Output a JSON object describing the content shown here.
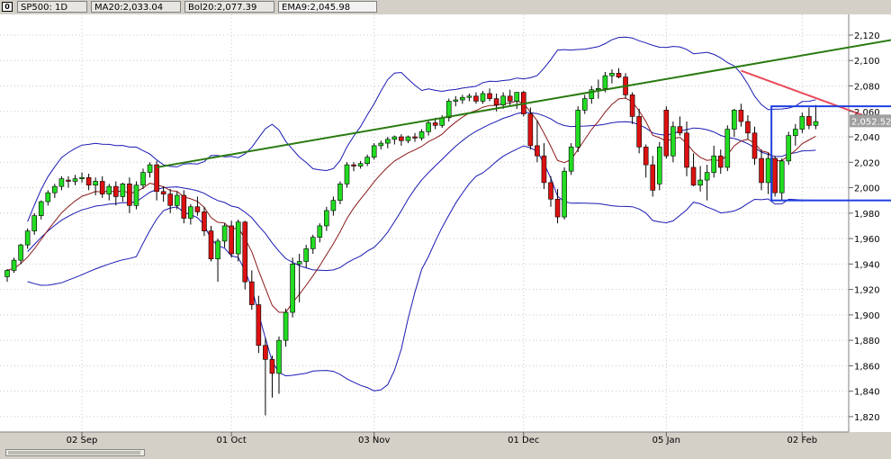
{
  "header": {
    "icon_label": "0",
    "symbol": "SP500: 1D",
    "ma": "MA20:2,033.04",
    "bol": "Bol20:2,077.39",
    "ema": "EMA9:2,045.98"
  },
  "colors": {
    "up": "#22dd22",
    "down": "#dd1111",
    "bands": "#1a1ab4",
    "ma": "#8b1a1a",
    "green_trendline": "#2a7a10",
    "red_trendline": "#ea4a5a",
    "range_box": "#2040e0"
  },
  "chart_data": {
    "type": "candlestick",
    "ylim": [
      1815,
      2132
    ],
    "y_ticks": [
      1820,
      1840,
      1860,
      1880,
      1900,
      1920,
      1940,
      1960,
      1980,
      2000,
      2020,
      2040,
      2060,
      2080,
      2100,
      2120
    ],
    "x_labels": [
      "02 Sep",
      "01 Oct",
      "03 Nov",
      "01 Dec",
      "05 Jan",
      "02 Feb"
    ],
    "x_label_index": [
      11,
      33,
      54,
      76,
      97,
      117
    ],
    "last_price": "2,052.52",
    "candles": [
      [
        1930,
        1936,
        1926,
        1935
      ],
      [
        1935,
        1945,
        1933,
        1943
      ],
      [
        1943,
        1956,
        1940,
        1955
      ],
      [
        1955,
        1968,
        1952,
        1966
      ],
      [
        1966,
        1980,
        1963,
        1978
      ],
      [
        1978,
        1990,
        1975,
        1989
      ],
      [
        1989,
        1998,
        1986,
        1996
      ],
      [
        1996,
        2003,
        1992,
        2001
      ],
      [
        2001,
        2009,
        1998,
        2007
      ],
      [
        2006,
        2009,
        2000,
        2005
      ],
      [
        2005,
        2010,
        2002,
        2007
      ],
      [
        2007,
        2012,
        2004,
        2008
      ],
      [
        2008,
        2011,
        1998,
        2002
      ],
      [
        2002,
        2008,
        1994,
        2005
      ],
      [
        2005,
        2009,
        1992,
        1995
      ],
      [
        1995,
        2003,
        1990,
        2001
      ],
      [
        2001,
        2005,
        1986,
        1993
      ],
      [
        1993,
        2004,
        1989,
        2003
      ],
      [
        2003,
        2008,
        1980,
        1986
      ],
      [
        1986,
        2005,
        1983,
        2002
      ],
      [
        2002,
        2015,
        1999,
        2012
      ],
      [
        2012,
        2020,
        2008,
        2018
      ],
      [
        2018,
        2021,
        1990,
        1997
      ],
      [
        1997,
        2001,
        1989,
        1995
      ],
      [
        1995,
        1999,
        1980,
        1986
      ],
      [
        1986,
        1997,
        1983,
        1994
      ],
      [
        1994,
        1998,
        1972,
        1976
      ],
      [
        1976,
        1987,
        1971,
        1985
      ],
      [
        1985,
        1993,
        1978,
        1981
      ],
      [
        1981,
        1985,
        1962,
        1966
      ],
      [
        1966,
        1970,
        1942,
        1944
      ],
      [
        1944,
        1960,
        1926,
        1958
      ],
      [
        1958,
        1972,
        1953,
        1970
      ],
      [
        1970,
        1974,
        1945,
        1948
      ],
      [
        1948,
        1975,
        1942,
        1973
      ],
      [
        1973,
        1974,
        1920,
        1926
      ],
      [
        1926,
        1935,
        1904,
        1908
      ],
      [
        1908,
        1915,
        1870,
        1876
      ],
      [
        1876,
        1882,
        1821,
        1865
      ],
      [
        1865,
        1868,
        1835,
        1854
      ],
      [
        1854,
        1883,
        1838,
        1880
      ],
      [
        1880,
        1905,
        1875,
        1902
      ],
      [
        1902,
        1945,
        1898,
        1940
      ],
      [
        1940,
        1948,
        1910,
        1942
      ],
      [
        1942,
        1955,
        1937,
        1952
      ],
      [
        1952,
        1963,
        1948,
        1961
      ],
      [
        1961,
        1972,
        1957,
        1970
      ],
      [
        1970,
        1985,
        1966,
        1982
      ],
      [
        1982,
        1993,
        1978,
        1990
      ],
      [
        1990,
        2005,
        1987,
        2003
      ],
      [
        2003,
        2020,
        2000,
        2018
      ],
      [
        2018,
        2020,
        2013,
        2017
      ],
      [
        2017,
        2021,
        2015,
        2019
      ],
      [
        2019,
        2026,
        2017,
        2024
      ],
      [
        2024,
        2035,
        2022,
        2033
      ],
      [
        2033,
        2037,
        2030,
        2035
      ],
      [
        2035,
        2040,
        2031,
        2038
      ],
      [
        2038,
        2041,
        2034,
        2040
      ],
      [
        2040,
        2042,
        2033,
        2037
      ],
      [
        2037,
        2041,
        2035,
        2040
      ],
      [
        2040,
        2043,
        2036,
        2039
      ],
      [
        2039,
        2046,
        2037,
        2044
      ],
      [
        2044,
        2053,
        2041,
        2051
      ],
      [
        2051,
        2055,
        2046,
        2049
      ],
      [
        2049,
        2057,
        2047,
        2055
      ],
      [
        2055,
        2070,
        2052,
        2068
      ],
      [
        2068,
        2072,
        2064,
        2069
      ],
      [
        2069,
        2073,
        2066,
        2071
      ],
      [
        2071,
        2074,
        2068,
        2072
      ],
      [
        2072,
        2075,
        2066,
        2068
      ],
      [
        2068,
        2076,
        2066,
        2074
      ],
      [
        2074,
        2078,
        2068,
        2070
      ],
      [
        2070,
        2074,
        2060,
        2065
      ],
      [
        2065,
        2075,
        2062,
        2072
      ],
      [
        2072,
        2077,
        2065,
        2068
      ],
      [
        2068,
        2073,
        2062,
        2075
      ],
      [
        2075,
        2076,
        2056,
        2058
      ],
      [
        2058,
        2063,
        2030,
        2033
      ],
      [
        2033,
        2053,
        2020,
        2025
      ],
      [
        2025,
        2035,
        1999,
        2004
      ],
      [
        2004,
        2009,
        1985,
        1991
      ],
      [
        1991,
        1999,
        1972,
        1977
      ],
      [
        1977,
        2016,
        1975,
        2013
      ],
      [
        2013,
        2035,
        2010,
        2032
      ],
      [
        2032,
        2064,
        2028,
        2061
      ],
      [
        2061,
        2073,
        2058,
        2070
      ],
      [
        2070,
        2080,
        2066,
        2077
      ],
      [
        2077,
        2085,
        2070,
        2078
      ],
      [
        2078,
        2091,
        2075,
        2088
      ],
      [
        2088,
        2093,
        2082,
        2090
      ],
      [
        2090,
        2094,
        2086,
        2087
      ],
      [
        2087,
        2090,
        2070,
        2073
      ],
      [
        2073,
        2075,
        2050,
        2056
      ],
      [
        2056,
        2062,
        2027,
        2032
      ],
      [
        2032,
        2034,
        2008,
        2018
      ],
      [
        2018,
        2025,
        1993,
        1998
      ],
      [
        2003,
        2036,
        1998,
        2032
      ],
      [
        2061,
        2064,
        2023,
        2025
      ],
      [
        2025,
        2052,
        2020,
        2048
      ],
      [
        2048,
        2056,
        2041,
        2043
      ],
      [
        2043,
        2052,
        2009,
        2016
      ],
      [
        2016,
        2027,
        2001,
        2002
      ],
      [
        2002,
        2017,
        1997,
        2006
      ],
      [
        2006,
        2018,
        1990,
        2012
      ],
      [
        2012,
        2033,
        2008,
        2025
      ],
      [
        2025,
        2030,
        2011,
        2016
      ],
      [
        2016,
        2049,
        2013,
        2046
      ],
      [
        2046,
        2062,
        2040,
        2061
      ],
      [
        2061,
        2066,
        2048,
        2052
      ],
      [
        2052,
        2057,
        2038,
        2043
      ],
      [
        2043,
        2048,
        2018,
        2023
      ],
      [
        2023,
        2030,
        1998,
        2004
      ],
      [
        2004,
        2027,
        1995,
        2023
      ],
      [
        2023,
        2025,
        1993,
        1996
      ],
      [
        1996,
        2023,
        1990,
        2021
      ],
      [
        2021,
        2044,
        2018,
        2041
      ],
      [
        2041,
        2050,
        2033,
        2046
      ],
      [
        2046,
        2059,
        2043,
        2056
      ],
      [
        2056,
        2063,
        2046,
        2049
      ],
      [
        2049,
        2065,
        2046,
        2052
      ]
    ],
    "green_trendline": [
      [
        22,
        2016
      ],
      [
        140,
        2125
      ]
    ],
    "red_trendline": [
      [
        108,
        2092
      ],
      [
        140,
        2030
      ]
    ],
    "range_box": {
      "from_index": 113,
      "to_index": 140,
      "top": 2064,
      "bottom": 1990
    }
  }
}
